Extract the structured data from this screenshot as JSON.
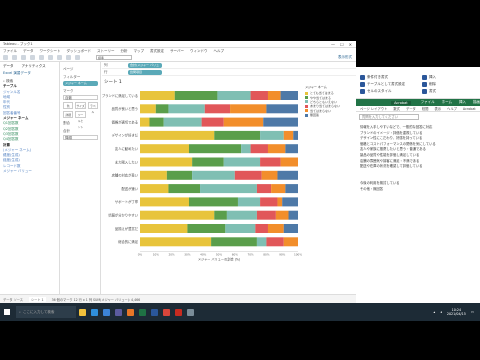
{
  "app": {
    "window_title": "Tableau - ブック1",
    "menu": [
      "ファイル",
      "データ",
      "ワークシート",
      "ダッシュボード",
      "ストーリー",
      "分析",
      "マップ",
      "書式設定",
      "サーバー",
      "ウィンドウ",
      "ヘルプ"
    ],
    "toolbar_select": "標準",
    "toolbar_right": "表示形式"
  },
  "data_pane": {
    "tabs": [
      "データ",
      "アナリティクス"
    ],
    "source": "Excel 演習データ",
    "search_placeholder": "検索",
    "sections": [
      {
        "label": "テーブル",
        "items": [
          "ジャンル名",
          "地域",
          "年代",
          "性別",
          "回答者番号"
        ]
      },
      {
        "label": "メジャー ネーム",
        "items": [
          "Q1回答数",
          "Q2回答数",
          "Q3回答数",
          "Q4回答数"
        ]
      },
      {
        "label": "計算",
        "items": [
          "(メジャー ネーム)",
          "緯度(生成)",
          "経度(生成)",
          "レコード数",
          "メジャー バリュー"
        ]
      }
    ]
  },
  "cards": {
    "pages_label": "ページ",
    "filters_label": "フィルター",
    "filter_pill": "メジャー ネーム",
    "marks_label": "マーク",
    "mark_type": "自動",
    "mark_buttons": [
      "色",
      "サイズ",
      "ラベル",
      "詳細",
      "ツールヒント"
    ],
    "percent_label": "割合",
    "sort_label": "合計",
    "sort_value": "降順"
  },
  "shelves": {
    "columns_label": "列",
    "columns_pill": "合計(メジャー バリュー)",
    "rows_label": "行",
    "rows_pill": "質問項目"
  },
  "viz": {
    "sheet_title": "シート 1",
    "axis_title": "メジャー バリューの割合 (%)"
  },
  "chart_data": {
    "type": "bar",
    "orientation": "horizontal-stacked-100",
    "title": "",
    "xlabel": "メジャー バリューの割合 (%)",
    "ylabel": "",
    "xlim": [
      0,
      100
    ],
    "xticks": [
      "0%",
      "10%",
      "20%",
      "30%",
      "40%",
      "50%",
      "60%",
      "70%",
      "80%",
      "90%",
      "100%"
    ],
    "categories": [
      "ブランドに満足している",
      "品質が良いと思う",
      "価格が適切である",
      "デザインが好きだ",
      "友人に勧めたい",
      "また購入したい",
      "店舗の対応が良い",
      "配送が速い",
      "サポートが丁寧",
      "情報が分かりやすい",
      "品揃えが豊富だ",
      "総合的に満足"
    ],
    "series": [
      {
        "name": "とても当てはまる",
        "color": "#e8c43b",
        "values": [
          22,
          10,
          6,
          47,
          31,
          33,
          17,
          18,
          31,
          47,
          30,
          45
        ]
      },
      {
        "name": "やや当てはまる",
        "color": "#5a9e4b",
        "values": [
          27,
          8,
          9,
          29,
          33,
          20,
          16,
          20,
          31,
          8,
          24,
          29
        ]
      },
      {
        "name": "どちらともいえない",
        "color": "#7fbfb3",
        "values": [
          21,
          23,
          24,
          15,
          6,
          23,
          27,
          36,
          14,
          19,
          19,
          6
        ]
      },
      {
        "name": "あまり当てはまらない",
        "color": "#e15759",
        "values": [
          11,
          16,
          14,
          0,
          11,
          13,
          17,
          9,
          11,
          12,
          8,
          11
        ]
      },
      {
        "name": "当てはまらない",
        "color": "#f28e2b",
        "values": [
          8,
          23,
          25,
          6,
          11,
          11,
          10,
          9,
          3,
          8,
          10,
          9
        ]
      },
      {
        "name": "無回答",
        "color": "#4e79a7",
        "values": [
          11,
          20,
          22,
          3,
          8,
          0,
          13,
          8,
          10,
          6,
          9,
          0
        ]
      }
    ],
    "legend_title": "メジャー ネーム",
    "legend_position": "right",
    "grid": false
  },
  "legend_header": "メジャー ネーム",
  "status": {
    "sheets": [
      "データ ソース",
      "シート 1"
    ],
    "info": "36 個のマーク  12 行 x 1 列  SUM(メジャー バリュー): 4,466"
  },
  "excel": {
    "ribbon_groups": [
      "条件付き書式",
      "テーブルとして書式設定",
      "セルのスタイル",
      "挿入",
      "削除",
      "書式"
    ],
    "green_bar": [
      "ファイル",
      "ホーム",
      "挿入",
      "描画"
    ],
    "selected_tab": "Acrobat",
    "tabs": [
      "ページ レイアウト",
      "数式",
      "データ",
      "校閲",
      "表示",
      "ヘルプ",
      "Acrobat"
    ],
    "input_placeholder": "質問を入力してください",
    "lines": [
      "情報を入手しやすいなどで、一般的な回答に対応",
      "ブランドのイメージ・評価を重視している",
      "デザイン性にこだわり、好感を持っている",
      "価格とコストパフォーマンスの関係を気にしている",
      "友人や家族に推薦したいと思う・普通である",
      "製品の品質や性能を評価し満足している",
      "店舗の雰囲気や接客に満足・不満である",
      "配送や在庫の状況を確認して評価している",
      "",
      "",
      "今後の利用を検討している",
      "その他・無回答"
    ]
  },
  "taskbar": {
    "search_placeholder": "ここに入力して検索",
    "apps": [
      "explorer",
      "edge",
      "mail",
      "store",
      "tableau",
      "excel",
      "word",
      "chrome",
      "acrobat",
      "files"
    ],
    "time": "10:24",
    "date": "2021/04/15"
  }
}
